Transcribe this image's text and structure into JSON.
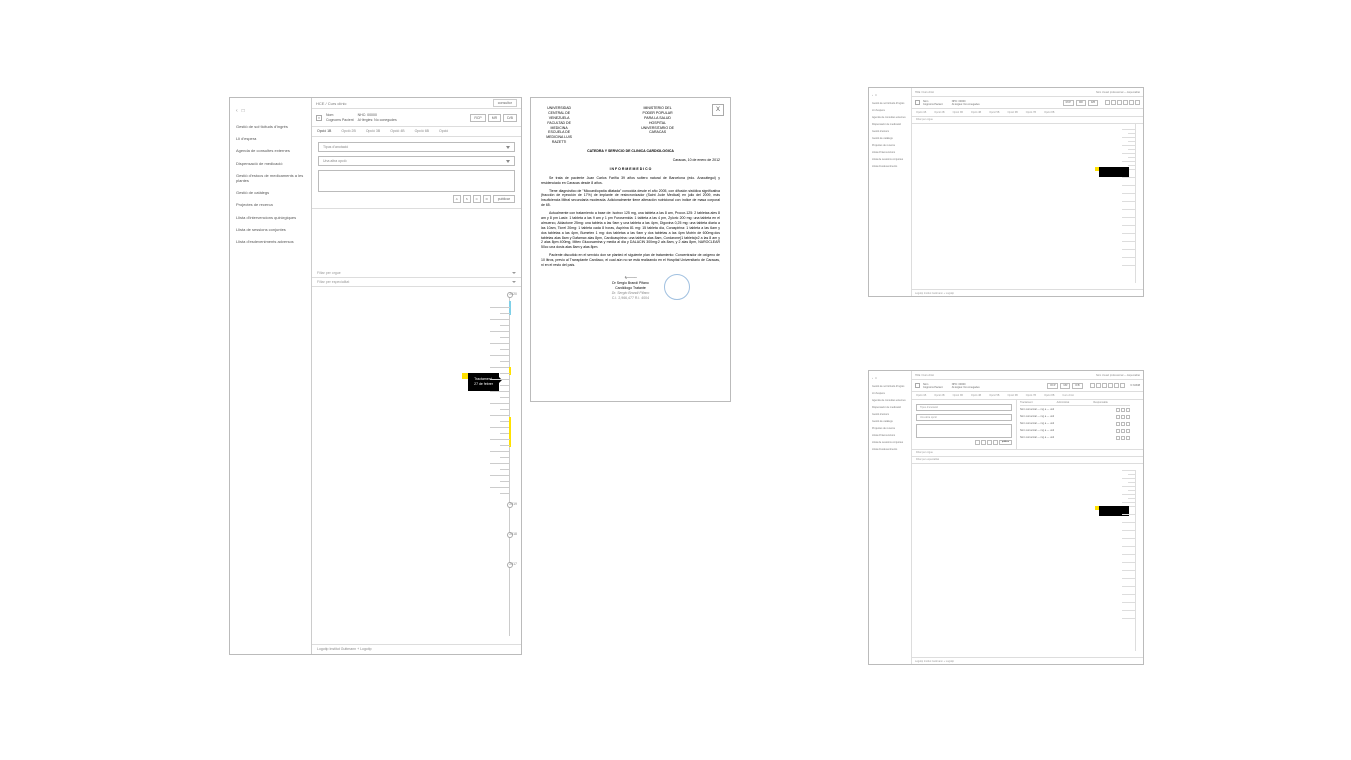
{
  "sidebar": {
    "breadcrumb": "HCE / Curs clínic",
    "items": [
      "Gestió de sol·licituds d'ingrés",
      "Lli d'espera",
      "Agenda de consultes externes",
      "Dispensació de medicació",
      "Gestió d'estocs de medicaments a les plantes",
      "Gestió de catàlegs",
      "Projectes de recerca",
      "Llista d'intervencions quirúrgiques",
      "Llista de sessions conjuntes",
      "Llista d'esdeveniments adversos"
    ]
  },
  "topbar": {
    "back": "‹",
    "sq": "□",
    "consultor": "consultor"
  },
  "patient": {
    "nom_label": "Nom",
    "cognoms": "Cognoms Pacient",
    "nhc": "NHC: 00000",
    "alergies": "Al·lèrgies: No conegudes",
    "badges": [
      "RCP",
      "MR",
      "D/B"
    ]
  },
  "tabs": [
    "Opció 1B",
    "Opció 2B",
    "Opció 3B",
    "Opció 4B",
    "Opció 6B",
    "Opció"
  ],
  "form": {
    "tipus": "Tipus d'anotació",
    "altra": "Una altra opció",
    "btns": [
      "A",
      "S",
      "C",
      "D"
    ],
    "publicar": "publicar"
  },
  "filters": {
    "orgue": "Filtar per orgue",
    "esp": "Filtar per especialitat"
  },
  "timeline": {
    "years": [
      "2020",
      "2019",
      "2018",
      "2017"
    ],
    "tooltip_t": "Tractament",
    "tooltip_d": "27 de febrer"
  },
  "footer": "Logotip Institut Guttmann + Logotip",
  "doc": {
    "h1a": "UNIVERSIDAD CENTRAL DE VENEZUELA",
    "h1b": "FACULTAD DE MEDICINA",
    "h1c": "ESCUELA DE MEDICINA LUIS RAZETTI",
    "h2a": "MINISTERIO DEL PODER POPULAR PARA LA SALUD",
    "h2b": "HOSPITAL UNIVERSITARIO DE CARACAS",
    "cat": "CATEDRA Y SERVICIO DE CLINICA CARDIOLOGICA",
    "date": "Caracas, 10 de enero de 2012",
    "title": "I N F O R M E   M E D I C O",
    "p1": "Se trata de paciente Juan Carlos Fariña 39 años soltero natural de Barcelona (edo. Anzoátegui) y residenciado en Caracas desde 8 años.",
    "p2": "Tiene diagnóstico de \"Miocardiopatía dilatada\" conocida desde el año 2005, con difusión sistólica significativa (fracción de eyección de 17%) de implante de resincronizador (Saint Jude Medical) en julio del 2009, más Insuficiencia Mitral secundaria moderada. Adicionalmente tiene alteración nutricional con índice de masa corporal de 65.",
    "p3": "Actualmente con tratamiento a base de: Isotrox 125 mg, una tableta a las 8 am, Procor-125: 2 tabletas ales 8 am y 8 pm Lasix: 1 tableta a las 9 am y 1 pm Furosemida: 1 tableta a las 4 pm, Zyloric 200 mg: una tableta en el almuerzo, Aldactone 25mg: una tableta a las 9am y una tableta a las 4pm, Digoxina 0,25 mg: una tableta diaria a las 10am, Ticrel 20mg: 1 tableta cada 8 horas, Aspirina 81 mg: 15 tableta día, Coraspirina: 1 tableta a las 6am y dos tabletas a las 4pm, Bumetex 1 mg: dos tabletas a las 9am y dos tabletas a las 4pm Motrin de 600mg:dos tabletas alas 8am y Dafamax alas 8pm, Cardioaspirina: una tableta alas 8am, Cordarone(1 tableta)x2 a las 8 am y 2 alas 8pm 400mg, Mitex Glucosamina y media al dia y DALACIN 300mg:2 als 8am, y 2 alas 8pm, NAROCLEAR 50cc una dosis alas 8am y alas 8pm.",
    "p4": "Paciente discutido en el servicio don se planteó el siguiente plan de tratamiento: Concentrador de oxígeno de 10 litros, previo al Transplante Cardíaco, el cual aún no se está realizando en el Hospital Universitario de Caracas, ni en el resto del país.",
    "sig1": "Dr Sergio Brandi Pifano",
    "sig2": "Cardiólogo Tratante",
    "sig3": "Dr. Sergio Brandi Pifano",
    "sig4": "C.I. 2,966,477 R.I. 4004",
    "close": "X"
  },
  "thumb": {
    "side_items": [
      "Gestió de sol·licituds d'ingrés",
      "Lli d'espera",
      "Agenda de consultes externes",
      "Dispensació de medicació",
      "Gestió d'estocs",
      "Gestió de catàlegs",
      "Projectes de recerca",
      "Llista d'intervencions",
      "Llista de sessions conjuntes",
      "Llista d'esdeveniments"
    ],
    "tabs": [
      "Opció 1B",
      "Opció 2B",
      "Opció 3B",
      "Opció 4B",
      "Opció 5B",
      "Opció 6B",
      "Opció 7B",
      "Opció 8B",
      "Curs clínic"
    ],
    "pager": "N 34338",
    "tbl_h": [
      "Tractament",
      "Administrat",
      "Responsable"
    ],
    "tbl_rows": [
      "Nom comercial — mg a — und",
      "Nom comercial — mg a — und",
      "Nom comercial — mg a — und",
      "Nom comercial — mg a — und",
      "Nom comercial — mg a — und"
    ],
    "bar_title": "HCE / Curs clínic",
    "bar_right": "Nom Usuari professional — Especialitat",
    "foot": "Logotip Institut Guttmann + Logotip"
  }
}
